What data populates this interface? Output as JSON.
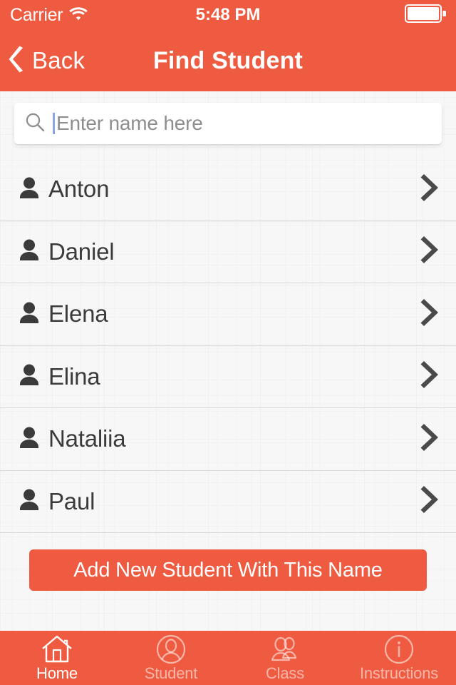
{
  "theme": {
    "accent": "#ef5b40",
    "page_bg": "#f7f7f7",
    "text": "#3b3b3b",
    "muted": "#8e8e8e"
  },
  "status_bar": {
    "carrier": "Carrier",
    "wifi_icon": "wifi-icon",
    "time": "5:48 PM",
    "battery_icon": "battery-icon"
  },
  "nav_bar": {
    "back_icon": "chevron-left-icon",
    "back_label": "Back",
    "title": "Find Student"
  },
  "search": {
    "icon": "search-icon",
    "placeholder": "Enter name here",
    "value": ""
  },
  "students": [
    {
      "name": "Anton",
      "icon": "person-icon",
      "accessory": "chevron-right-icon"
    },
    {
      "name": "Daniel",
      "icon": "person-icon",
      "accessory": "chevron-right-icon"
    },
    {
      "name": "Elena",
      "icon": "person-icon",
      "accessory": "chevron-right-icon"
    },
    {
      "name": "Elina",
      "icon": "person-icon",
      "accessory": "chevron-right-icon"
    },
    {
      "name": "Nataliia",
      "icon": "person-icon",
      "accessory": "chevron-right-icon"
    },
    {
      "name": "Paul",
      "icon": "person-icon",
      "accessory": "chevron-right-icon"
    }
  ],
  "add_button": {
    "label": "Add New Student With This Name"
  },
  "tab_bar": {
    "items": [
      {
        "label": "Home",
        "icon": "home-icon",
        "active": true
      },
      {
        "label": "Student",
        "icon": "person-circle-icon",
        "active": false
      },
      {
        "label": "Class",
        "icon": "people-group-icon",
        "active": false
      },
      {
        "label": "Instructions",
        "icon": "info-circle-icon",
        "active": false
      }
    ]
  }
}
